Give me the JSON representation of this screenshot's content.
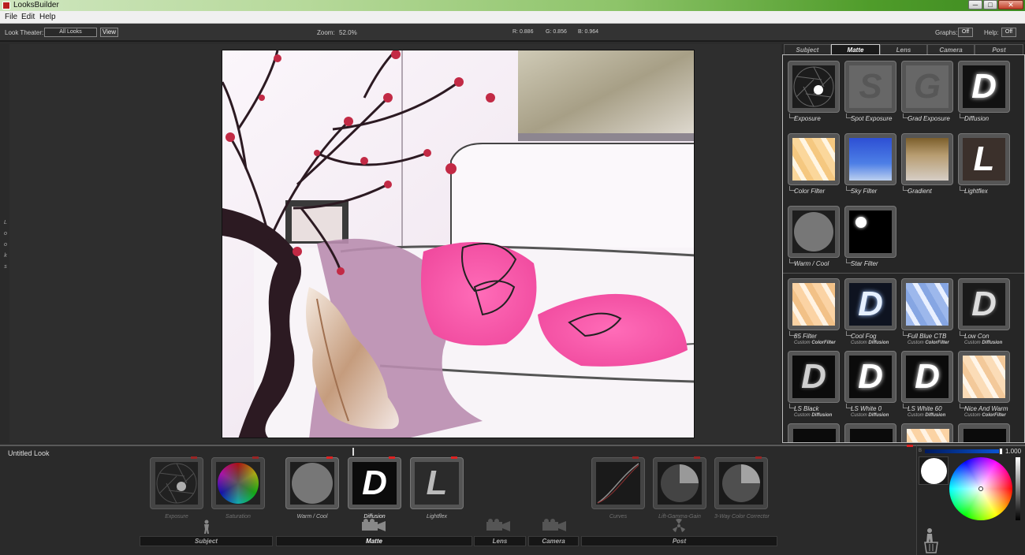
{
  "window": {
    "title": "LooksBuilder",
    "min": "─",
    "max": "□",
    "close": "✕"
  },
  "menu": [
    "File",
    "Edit",
    "Help"
  ],
  "toolbar": {
    "look_theater_label": "Look Theater:",
    "look_theater_value": "All Looks",
    "view_button": "View",
    "zoom_label": "Zoom:",
    "zoom_value": "52.0%",
    "r": "R: 0.886",
    "g": "G: 0.856",
    "b": "B: 0.964",
    "graphs_label": "Graphs:",
    "graphs_value": "Off",
    "help_label": "Help:",
    "help_value": "Off"
  },
  "looks_sidebar": [
    "L",
    "o",
    "o",
    "k",
    "s"
  ],
  "right_tabs": [
    "Subject",
    "Matte",
    "Lens",
    "Camera",
    "Post"
  ],
  "right_active_tab": "Matte",
  "matte_tools": [
    {
      "label": "Exposure",
      "icon": "aperture-icon"
    },
    {
      "label": "Spot Exposure",
      "icon": "spot-exposure-s-icon",
      "glyph": "S"
    },
    {
      "label": "Grad Exposure",
      "icon": "grad-exposure-g-icon",
      "glyph": "G"
    },
    {
      "label": "Diffusion",
      "icon": "diffusion-d-icon",
      "glyph": "D"
    },
    {
      "label": "Color Filter",
      "icon": "color-filter-icon"
    },
    {
      "label": "Sky Filter",
      "icon": "sky-filter-icon"
    },
    {
      "label": "Gradient",
      "icon": "gradient-icon"
    },
    {
      "label": "Lightflex",
      "icon": "lightflex-l-icon",
      "glyph": "L"
    },
    {
      "label": "Warm / Cool",
      "icon": "warm-cool-icon"
    },
    {
      "label": "Star Filter",
      "icon": "star-filter-icon"
    }
  ],
  "presets": [
    {
      "label": "85 Filter",
      "sub": "Custom",
      "type": "ColorFilter"
    },
    {
      "label": "Cool Fog",
      "sub": "Custom",
      "type": "Diffusion"
    },
    {
      "label": "Full Blue CTB",
      "sub": "Custom",
      "type": "ColorFilter"
    },
    {
      "label": "Low Con",
      "sub": "Custom",
      "type": "Diffusion"
    },
    {
      "label": "LS Black",
      "sub": "Custom",
      "type": "Diffusion"
    },
    {
      "label": "LS White 0",
      "sub": "Custom",
      "type": "Diffusion"
    },
    {
      "label": "LS White 60",
      "sub": "Custom",
      "type": "Diffusion"
    },
    {
      "label": "Nice And Warm",
      "sub": "Custom",
      "type": "ColorFilter"
    }
  ],
  "look_name": "Untitled Look",
  "stack_tools": [
    {
      "label": "Exposure",
      "icon": "aperture-icon"
    },
    {
      "label": "Saturation",
      "icon": "saturation-wheel-icon"
    },
    {
      "label": "Warm / Cool",
      "icon": "warm-cool-icon"
    },
    {
      "label": "Diffusion",
      "icon": "diffusion-d-icon",
      "glyph": "D"
    },
    {
      "label": "Lightflex",
      "icon": "lightflex-l-icon",
      "glyph": "L"
    },
    {
      "label": "Curves",
      "icon": "curves-icon"
    },
    {
      "label": "Lift-Gamma-Gain",
      "icon": "lift-gamma-gain-icon"
    },
    {
      "label": "3-Way Color Corrector",
      "icon": "three-way-corrector-icon"
    }
  ],
  "bottom_categories": [
    "Subject",
    "Matte",
    "Lens",
    "Camera",
    "Post"
  ],
  "color_panel": {
    "slider_value": "1.000",
    "slider_label": "B"
  },
  "colors": {
    "accent": "#d22222",
    "background": "#2b2b2b",
    "panel": "#262626"
  }
}
